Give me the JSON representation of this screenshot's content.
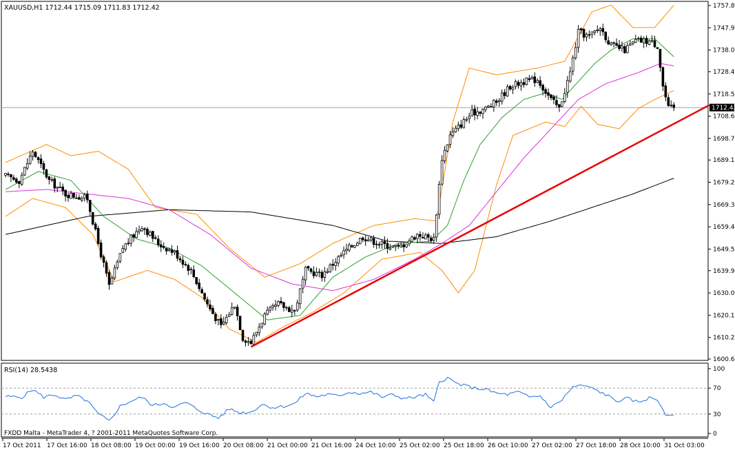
{
  "chart_header": "XAUUSD,H1  1712.44 1715.09 1711.83 1712.42",
  "rsi_header": "RSI(14) 28.5438",
  "copyright": "FXDD Malta - MetaTrader 4, ? 2001-2011 MetaQuotes Software Corp.",
  "colors": {
    "bg": "#ffffff",
    "axis": "#000000",
    "candle": "#000000",
    "bollinger": "#ff8c00",
    "ma_fast": "#2e9e2e",
    "ma_mid": "#d633d6",
    "ma_slow": "#000000",
    "trendline": "#e60000",
    "rsi": "#1e6fe0",
    "level": "#a0a0a0"
  },
  "chart_data": [
    {
      "type": "candlestick",
      "symbol": "XAUUSD",
      "timeframe": "H1",
      "current_price": "1712.42",
      "ylim": [
        1600.6,
        1757.8
      ],
      "y_ticks": [
        "1757.80",
        "1747.90",
        "1738.00",
        "1728.40",
        "1718.50",
        "1708.60",
        "1698.70",
        "1689.10",
        "1679.20",
        "1669.30",
        "1659.40",
        "1649.50",
        "1639.90",
        "1630.00",
        "1620.10",
        "1610.20",
        "1600.60"
      ],
      "x_ticks": [
        "17 Oct 2011",
        "17 Oct 16:00",
        "18 Oct 08:00",
        "19 Oct 00:00",
        "19 Oct 16:00",
        "20 Oct 08:00",
        "21 Oct 00:00",
        "21 Oct 16:00",
        "24 Oct 10:00",
        "25 Oct 02:00",
        "25 Oct 18:00",
        "26 Oct 10:00",
        "27 Oct 02:00",
        "27 Oct 18:00",
        "28 Oct 10:00",
        "31 Oct 03:00"
      ],
      "close_anchors": [
        {
          "bar": 0,
          "close": 1682
        },
        {
          "bar": 5,
          "close": 1680
        },
        {
          "bar": 10,
          "close": 1693
        },
        {
          "bar": 16,
          "close": 1680
        },
        {
          "bar": 22,
          "close": 1674
        },
        {
          "bar": 30,
          "close": 1672
        },
        {
          "bar": 34,
          "close": 1652
        },
        {
          "bar": 38,
          "close": 1633
        },
        {
          "bar": 43,
          "close": 1650
        },
        {
          "bar": 50,
          "close": 1660
        },
        {
          "bar": 56,
          "close": 1652
        },
        {
          "bar": 62,
          "close": 1648
        },
        {
          "bar": 68,
          "close": 1640
        },
        {
          "bar": 74,
          "close": 1625
        },
        {
          "bar": 79,
          "close": 1615
        },
        {
          "bar": 84,
          "close": 1625
        },
        {
          "bar": 87,
          "close": 1610
        },
        {
          "bar": 90,
          "close": 1608
        },
        {
          "bar": 95,
          "close": 1620
        },
        {
          "bar": 100,
          "close": 1625
        },
        {
          "bar": 106,
          "close": 1622
        },
        {
          "bar": 110,
          "close": 1640
        },
        {
          "bar": 116,
          "close": 1638
        },
        {
          "bar": 124,
          "close": 1648
        },
        {
          "bar": 131,
          "close": 1655
        },
        {
          "bar": 137,
          "close": 1652
        },
        {
          "bar": 144,
          "close": 1650
        },
        {
          "bar": 151,
          "close": 1656
        },
        {
          "bar": 157,
          "close": 1654
        },
        {
          "bar": 160,
          "close": 1690
        },
        {
          "bar": 163,
          "close": 1700
        },
        {
          "bar": 167,
          "close": 1705
        },
        {
          "bar": 171,
          "close": 1710
        },
        {
          "bar": 176,
          "close": 1712
        },
        {
          "bar": 180,
          "close": 1715
        },
        {
          "bar": 185,
          "close": 1722
        },
        {
          "bar": 190,
          "close": 1724
        },
        {
          "bar": 195,
          "close": 1725
        },
        {
          "bar": 200,
          "close": 1716
        },
        {
          "bar": 203,
          "close": 1712
        },
        {
          "bar": 207,
          "close": 1728
        },
        {
          "bar": 210,
          "close": 1746
        },
        {
          "bar": 214,
          "close": 1744
        },
        {
          "bar": 218,
          "close": 1748
        },
        {
          "bar": 222,
          "close": 1740
        },
        {
          "bar": 227,
          "close": 1738
        },
        {
          "bar": 231,
          "close": 1742
        },
        {
          "bar": 236,
          "close": 1742
        },
        {
          "bar": 239,
          "close": 1740
        },
        {
          "bar": 241,
          "close": 1722
        },
        {
          "bar": 243,
          "close": 1712
        },
        {
          "bar": 245,
          "close": 1712.42
        }
      ],
      "bollinger_upper_anchors": [
        {
          "bar": 0,
          "value": 1688
        },
        {
          "bar": 15,
          "value": 1696
        },
        {
          "bar": 24,
          "value": 1691
        },
        {
          "bar": 34,
          "value": 1693
        },
        {
          "bar": 45,
          "value": 1685
        },
        {
          "bar": 55,
          "value": 1668
        },
        {
          "bar": 70,
          "value": 1665
        },
        {
          "bar": 82,
          "value": 1650
        },
        {
          "bar": 95,
          "value": 1637
        },
        {
          "bar": 108,
          "value": 1643
        },
        {
          "bar": 120,
          "value": 1652
        },
        {
          "bar": 135,
          "value": 1660
        },
        {
          "bar": 150,
          "value": 1663
        },
        {
          "bar": 158,
          "value": 1662
        },
        {
          "bar": 164,
          "value": 1706
        },
        {
          "bar": 170,
          "value": 1730
        },
        {
          "bar": 180,
          "value": 1727
        },
        {
          "bar": 195,
          "value": 1730
        },
        {
          "bar": 205,
          "value": 1733
        },
        {
          "bar": 215,
          "value": 1755
        },
        {
          "bar": 222,
          "value": 1758
        },
        {
          "bar": 230,
          "value": 1748
        },
        {
          "bar": 238,
          "value": 1748
        },
        {
          "bar": 245,
          "value": 1758
        }
      ],
      "bollinger_lower_anchors": [
        {
          "bar": 0,
          "value": 1664
        },
        {
          "bar": 10,
          "value": 1672
        },
        {
          "bar": 22,
          "value": 1668
        },
        {
          "bar": 32,
          "value": 1656
        },
        {
          "bar": 40,
          "value": 1635
        },
        {
          "bar": 52,
          "value": 1640
        },
        {
          "bar": 62,
          "value": 1636
        },
        {
          "bar": 72,
          "value": 1628
        },
        {
          "bar": 82,
          "value": 1614
        },
        {
          "bar": 92,
          "value": 1608
        },
        {
          "bar": 102,
          "value": 1615
        },
        {
          "bar": 112,
          "value": 1621
        },
        {
          "bar": 124,
          "value": 1630
        },
        {
          "bar": 138,
          "value": 1645
        },
        {
          "bar": 152,
          "value": 1648
        },
        {
          "bar": 160,
          "value": 1640
        },
        {
          "bar": 166,
          "value": 1630
        },
        {
          "bar": 172,
          "value": 1640
        },
        {
          "bar": 180,
          "value": 1678
        },
        {
          "bar": 186,
          "value": 1700
        },
        {
          "bar": 198,
          "value": 1706
        },
        {
          "bar": 205,
          "value": 1704
        },
        {
          "bar": 211,
          "value": 1713
        },
        {
          "bar": 217,
          "value": 1705
        },
        {
          "bar": 225,
          "value": 1703
        },
        {
          "bar": 232,
          "value": 1712
        },
        {
          "bar": 238,
          "value": 1716
        },
        {
          "bar": 245,
          "value": 1720
        }
      ],
      "ma_fast_anchors": [
        {
          "bar": 0,
          "value": 1676
        },
        {
          "bar": 12,
          "value": 1684
        },
        {
          "bar": 24,
          "value": 1680
        },
        {
          "bar": 36,
          "value": 1664
        },
        {
          "bar": 48,
          "value": 1654
        },
        {
          "bar": 60,
          "value": 1650
        },
        {
          "bar": 72,
          "value": 1642
        },
        {
          "bar": 84,
          "value": 1630
        },
        {
          "bar": 96,
          "value": 1618
        },
        {
          "bar": 108,
          "value": 1620
        },
        {
          "bar": 120,
          "value": 1637
        },
        {
          "bar": 132,
          "value": 1646
        },
        {
          "bar": 144,
          "value": 1652
        },
        {
          "bar": 156,
          "value": 1653
        },
        {
          "bar": 162,
          "value": 1660
        },
        {
          "bar": 168,
          "value": 1680
        },
        {
          "bar": 174,
          "value": 1696
        },
        {
          "bar": 182,
          "value": 1708
        },
        {
          "bar": 190,
          "value": 1716
        },
        {
          "bar": 198,
          "value": 1719
        },
        {
          "bar": 204,
          "value": 1716
        },
        {
          "bar": 210,
          "value": 1724
        },
        {
          "bar": 216,
          "value": 1732
        },
        {
          "bar": 222,
          "value": 1738
        },
        {
          "bar": 230,
          "value": 1743
        },
        {
          "bar": 238,
          "value": 1743
        },
        {
          "bar": 245,
          "value": 1735
        }
      ],
      "ma_mid_anchors": [
        {
          "bar": 0,
          "value": 1675
        },
        {
          "bar": 15,
          "value": 1676
        },
        {
          "bar": 30,
          "value": 1674
        },
        {
          "bar": 45,
          "value": 1672
        },
        {
          "bar": 60,
          "value": 1667
        },
        {
          "bar": 75,
          "value": 1656
        },
        {
          "bar": 90,
          "value": 1641
        },
        {
          "bar": 105,
          "value": 1634
        },
        {
          "bar": 120,
          "value": 1631
        },
        {
          "bar": 135,
          "value": 1636
        },
        {
          "bar": 150,
          "value": 1645
        },
        {
          "bar": 160,
          "value": 1652
        },
        {
          "bar": 170,
          "value": 1660
        },
        {
          "bar": 180,
          "value": 1675
        },
        {
          "bar": 190,
          "value": 1690
        },
        {
          "bar": 200,
          "value": 1703
        },
        {
          "bar": 210,
          "value": 1716
        },
        {
          "bar": 220,
          "value": 1723
        },
        {
          "bar": 232,
          "value": 1728
        },
        {
          "bar": 240,
          "value": 1732
        },
        {
          "bar": 245,
          "value": 1731
        }
      ],
      "ma_slow_anchors": [
        {
          "bar": 0,
          "value": 1656
        },
        {
          "bar": 30,
          "value": 1664
        },
        {
          "bar": 60,
          "value": 1667
        },
        {
          "bar": 90,
          "value": 1666
        },
        {
          "bar": 120,
          "value": 1660
        },
        {
          "bar": 140,
          "value": 1653
        },
        {
          "bar": 160,
          "value": 1652
        },
        {
          "bar": 180,
          "value": 1655
        },
        {
          "bar": 200,
          "value": 1662
        },
        {
          "bar": 215,
          "value": 1668
        },
        {
          "bar": 230,
          "value": 1674
        },
        {
          "bar": 245,
          "value": 1681
        }
      ],
      "trendline": {
        "start": {
          "bar": 90,
          "value": 1606
        },
        "end": {
          "bar": 258,
          "value": 1713.5
        }
      }
    },
    {
      "type": "line",
      "name": "RSI(14)",
      "value": "28.5438",
      "ylim": [
        0,
        100
      ],
      "y_ticks": [
        "100",
        "70",
        "30",
        "0"
      ],
      "levels": [
        70,
        30
      ],
      "rsi_anchors": [
        {
          "bar": 0,
          "value": 57
        },
        {
          "bar": 6,
          "value": 56
        },
        {
          "bar": 10,
          "value": 68
        },
        {
          "bar": 14,
          "value": 56
        },
        {
          "bar": 18,
          "value": 60
        },
        {
          "bar": 22,
          "value": 52
        },
        {
          "bar": 26,
          "value": 58
        },
        {
          "bar": 30,
          "value": 50
        },
        {
          "bar": 34,
          "value": 30
        },
        {
          "bar": 38,
          "value": 19
        },
        {
          "bar": 42,
          "value": 42
        },
        {
          "bar": 46,
          "value": 50
        },
        {
          "bar": 50,
          "value": 56
        },
        {
          "bar": 54,
          "value": 43
        },
        {
          "bar": 58,
          "value": 47
        },
        {
          "bar": 62,
          "value": 40
        },
        {
          "bar": 66,
          "value": 48
        },
        {
          "bar": 70,
          "value": 38
        },
        {
          "bar": 74,
          "value": 30
        },
        {
          "bar": 78,
          "value": 24
        },
        {
          "bar": 82,
          "value": 38
        },
        {
          "bar": 86,
          "value": 32
        },
        {
          "bar": 90,
          "value": 33
        },
        {
          "bar": 94,
          "value": 45
        },
        {
          "bar": 98,
          "value": 40
        },
        {
          "bar": 102,
          "value": 42
        },
        {
          "bar": 106,
          "value": 46
        },
        {
          "bar": 110,
          "value": 62
        },
        {
          "bar": 114,
          "value": 57
        },
        {
          "bar": 118,
          "value": 60
        },
        {
          "bar": 122,
          "value": 58
        },
        {
          "bar": 126,
          "value": 64
        },
        {
          "bar": 130,
          "value": 62
        },
        {
          "bar": 134,
          "value": 64
        },
        {
          "bar": 138,
          "value": 56
        },
        {
          "bar": 142,
          "value": 60
        },
        {
          "bar": 146,
          "value": 54
        },
        {
          "bar": 150,
          "value": 56
        },
        {
          "bar": 154,
          "value": 60
        },
        {
          "bar": 157,
          "value": 48
        },
        {
          "bar": 159,
          "value": 80
        },
        {
          "bar": 162,
          "value": 86
        },
        {
          "bar": 165,
          "value": 78
        },
        {
          "bar": 168,
          "value": 74
        },
        {
          "bar": 172,
          "value": 70
        },
        {
          "bar": 176,
          "value": 68
        },
        {
          "bar": 180,
          "value": 62
        },
        {
          "bar": 184,
          "value": 60
        },
        {
          "bar": 188,
          "value": 64
        },
        {
          "bar": 192,
          "value": 56
        },
        {
          "bar": 196,
          "value": 58
        },
        {
          "bar": 200,
          "value": 40
        },
        {
          "bar": 204,
          "value": 52
        },
        {
          "bar": 208,
          "value": 72
        },
        {
          "bar": 212,
          "value": 74
        },
        {
          "bar": 216,
          "value": 68
        },
        {
          "bar": 220,
          "value": 60
        },
        {
          "bar": 224,
          "value": 50
        },
        {
          "bar": 228,
          "value": 54
        },
        {
          "bar": 232,
          "value": 48
        },
        {
          "bar": 236,
          "value": 55
        },
        {
          "bar": 239,
          "value": 52
        },
        {
          "bar": 241,
          "value": 38
        },
        {
          "bar": 242,
          "value": 28
        },
        {
          "bar": 245,
          "value": 28.5
        }
      ]
    }
  ]
}
